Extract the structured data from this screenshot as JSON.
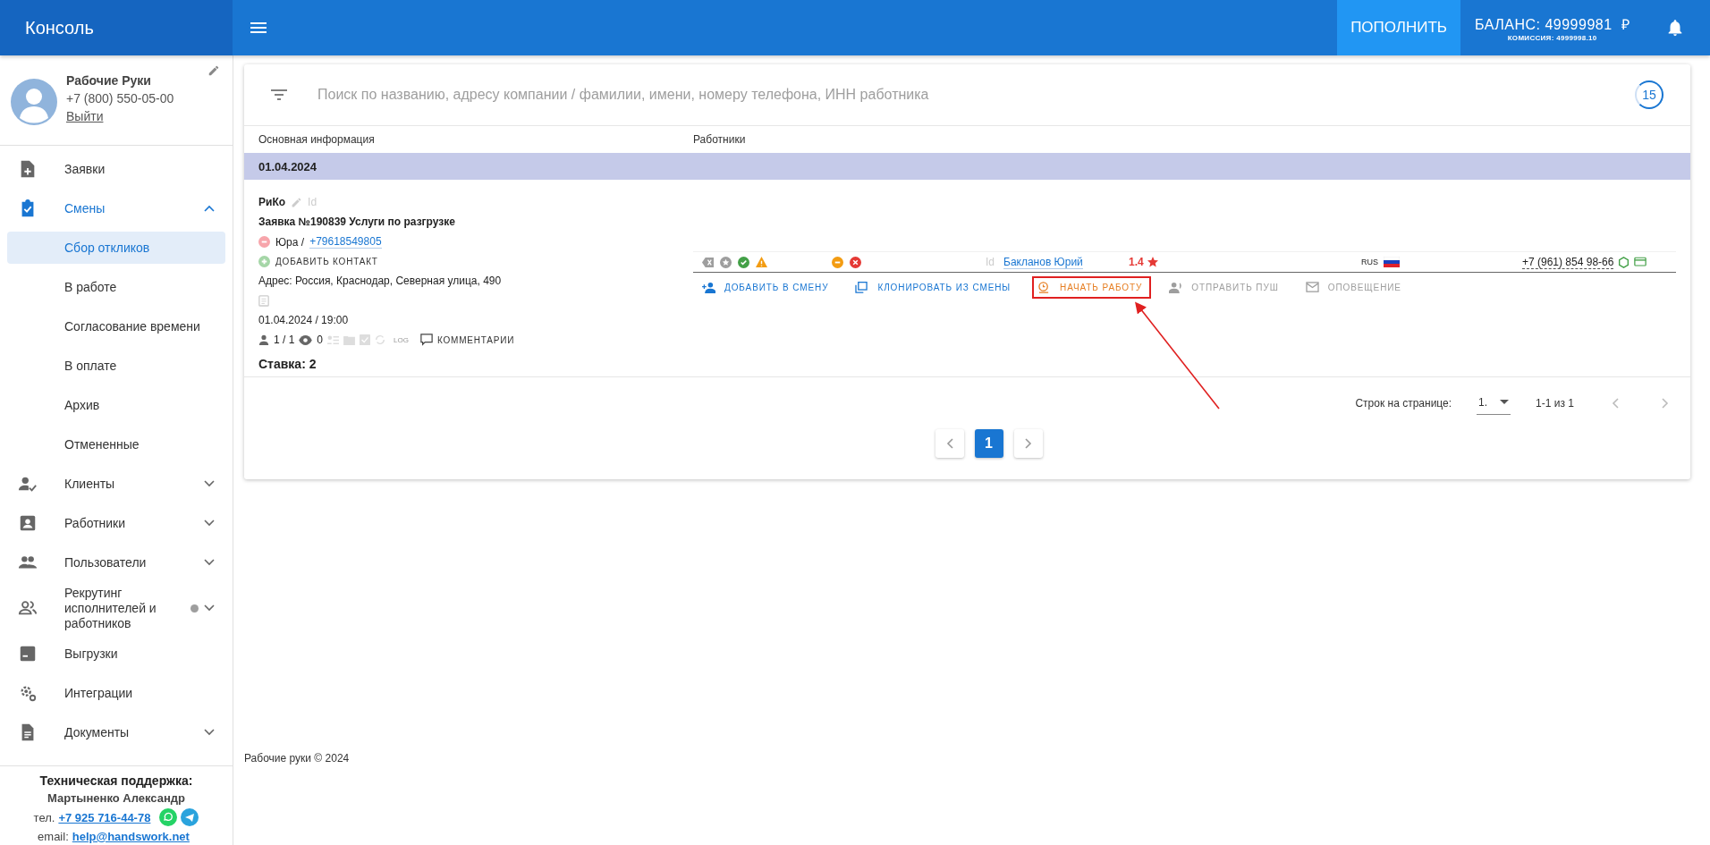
{
  "header": {
    "title": "Консоль",
    "topup_button": "ПОПОЛНИТЬ",
    "balance": "БАЛАНС: 49999981",
    "currency": "₽",
    "commission": "КОМИССИЯ: 4999998.10"
  },
  "profile": {
    "name": "Рабочие Руки",
    "phone": "+7 (800) 550-05-00",
    "logout": "Выйти"
  },
  "sidebar": {
    "items": [
      {
        "label": "Заявки",
        "kind": "link",
        "selected": false,
        "dot": false
      },
      {
        "label": "Смены",
        "kind": "group",
        "selected": true,
        "expanded": true,
        "dot": false,
        "children": [
          {
            "label": "Сбор откликов",
            "selected": true
          },
          {
            "label": "В работе",
            "selected": false
          },
          {
            "label": "Согласование времени",
            "selected": false
          },
          {
            "label": "В оплате",
            "selected": false
          },
          {
            "label": "Архив",
            "selected": false
          },
          {
            "label": "Отмененные",
            "selected": false
          }
        ]
      },
      {
        "label": "Клиенты",
        "kind": "group",
        "selected": false,
        "expanded": false,
        "dot": false
      },
      {
        "label": "Работники",
        "kind": "group",
        "selected": false,
        "expanded": false,
        "dot": false
      },
      {
        "label": "Пользователи",
        "kind": "group",
        "selected": false,
        "expanded": false,
        "dot": false
      },
      {
        "label": "Рекрутинг исполнителей и работников",
        "kind": "group",
        "selected": false,
        "expanded": false,
        "dot": true
      },
      {
        "label": "Выгрузки",
        "kind": "link",
        "selected": false,
        "dot": false
      },
      {
        "label": "Интеграции",
        "kind": "link",
        "selected": false,
        "dot": false
      },
      {
        "label": "Документы",
        "kind": "group",
        "selected": false,
        "expanded": false,
        "dot": false
      }
    ]
  },
  "support": {
    "title": "Техническая поддержка:",
    "name": "Мартыненко Александр",
    "phone_label": "тел.",
    "phone": "+7 925 716-44-78",
    "email_label": "email:",
    "email": "help@handswork.net"
  },
  "search": {
    "placeholder": "Поиск по названию, адресу компании / фамилии, имени, номеру телефона, ИНН работника",
    "count": "15"
  },
  "table": {
    "columns": [
      "Основная информация",
      "Работники"
    ],
    "group_date": "01.04.2024"
  },
  "order": {
    "company": "РиКо",
    "id_label": "Id",
    "title": "Заявка №190839 Услуги по разгрузке",
    "contact_name": "Юра /",
    "contact_phone": "+79618549805",
    "add_contact": "ДОБАВИТЬ КОНТАКТ",
    "address": "Адрес: Россия, Краснодар, Северная улица, 490",
    "datetime": "01.04.2024 / 19:00",
    "workers_count": "1 / 1",
    "views": "0",
    "log": "LOG",
    "comments": "КОММЕНТАРИИ",
    "rate": "Ставка: 2"
  },
  "worker": {
    "status_icons": [
      {
        "kind": "tag-x"
      },
      {
        "kind": "star"
      },
      {
        "kind": "check"
      },
      {
        "kind": "warning"
      }
    ],
    "mark_icons": [
      {
        "kind": "minus"
      },
      {
        "kind": "cross"
      }
    ],
    "id_label": "Id",
    "name": "Бакланов Юрий",
    "rating": "1.4",
    "citizenship": "RUS",
    "phone": "+7 (961) 854 98-66"
  },
  "actions": [
    {
      "label": "ДОБАВИТЬ В СМЕНУ",
      "kind": "primary",
      "highlighted": false
    },
    {
      "label": "КЛОНИРОВАТЬ ИЗ СМЕНЫ",
      "kind": "primary",
      "highlighted": false
    },
    {
      "label": "НАЧАТЬ РАБОТУ",
      "kind": "warning",
      "highlighted": true
    },
    {
      "label": "ОТПРАВИТЬ ПУШ",
      "kind": "muted",
      "highlighted": false
    },
    {
      "label": "ОПОВЕЩЕНИЕ",
      "kind": "muted",
      "highlighted": false
    }
  ],
  "pagination": {
    "rows_label": "Строк на странице:",
    "rows_value": "1.",
    "range": "1-1 из 1",
    "pages": [
      {
        "label": "1",
        "selected": true
      }
    ]
  },
  "footer": "Рабочие руки © 2024"
}
